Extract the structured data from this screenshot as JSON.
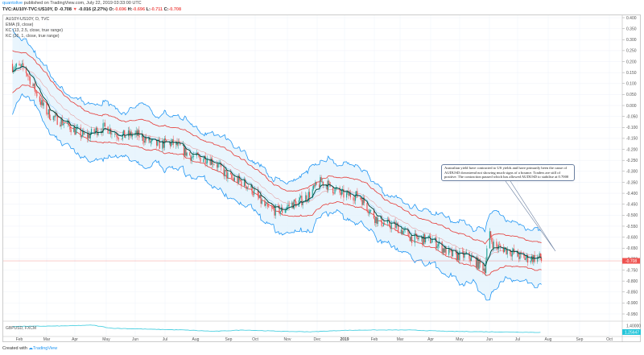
{
  "header": {
    "user": "quantolive",
    "published": "published on TradingView.com, July 22, 2019 03:33:00 UTC",
    "symbol": "TVC:AU10Y-TVC:US10Y, D",
    "last": "-0.708",
    "change_arrow": "▼",
    "change": "-0.016 (2.27%)",
    "o_label": "O:",
    "o": "-0.696",
    "h_label": "H:",
    "h": "-0.696",
    "l_label": "L:",
    "l": "-0.711",
    "c_label": "C:",
    "c": "-0.708"
  },
  "legend": [
    "AU10Y-US10Y, D, TVC",
    "EMA (9, close)",
    "KC (13, 2.5, close, true range)",
    "KC (26, 1, close, true range)"
  ],
  "annotation": "Australian yield have contracted to US yields and have primarily been the cause of AUDUSD downtrend not showing much signs of a bounce. Traders are still of positive. The contraction paused which has allowed AUDUSD to stabilise at 0.7000",
  "footer": {
    "created": "Created with",
    "brand": "TradingView"
  },
  "colors": {
    "up": "#26a69a",
    "down": "#ef5350",
    "ema": "#004d40",
    "kc1": "#2196f3",
    "kc2": "#e53935",
    "fill": "#e3f2fd",
    "sub": "#4dd0e1"
  },
  "chart_data": {
    "type": "candlestick",
    "title": "AU10Y-US10Y, D, TVC",
    "x_unit": "days since 2018-02-01",
    "price_keypoints": [
      [
        -7,
        0.19
      ],
      [
        5,
        0.16
      ],
      [
        14,
        0.08
      ],
      [
        25,
        0.0
      ],
      [
        35,
        -0.05
      ],
      [
        45,
        -0.09
      ],
      [
        55,
        -0.11
      ],
      [
        70,
        -0.13
      ],
      [
        90,
        -0.11
      ],
      [
        110,
        -0.13
      ],
      [
        130,
        -0.16
      ],
      [
        150,
        -0.17
      ],
      [
        170,
        -0.21
      ],
      [
        190,
        -0.24
      ],
      [
        210,
        -0.3
      ],
      [
        225,
        -0.34
      ],
      [
        240,
        -0.4
      ],
      [
        255,
        -0.46
      ],
      [
        270,
        -0.49
      ],
      [
        290,
        -0.42
      ],
      [
        310,
        -0.36
      ],
      [
        325,
        -0.38
      ],
      [
        340,
        -0.41
      ],
      [
        350,
        -0.43
      ],
      [
        365,
        -0.5
      ],
      [
        380,
        -0.55
      ],
      [
        395,
        -0.58
      ],
      [
        410,
        -0.6
      ],
      [
        420,
        -0.62
      ],
      [
        440,
        -0.66
      ],
      [
        455,
        -0.69
      ],
      [
        470,
        -0.72
      ],
      [
        478,
        -0.73
      ],
      [
        482,
        -0.57
      ],
      [
        488,
        -0.64
      ],
      [
        500,
        -0.67
      ],
      [
        515,
        -0.68
      ],
      [
        525,
        -0.69
      ],
      [
        536,
        -0.708
      ]
    ],
    "ema_period": 9,
    "kc_outer": {
      "period": 13,
      "mult": 2.5
    },
    "kc_inner": {
      "period": 26,
      "mult": 1
    },
    "yaxis_ticks": [
      "0.400",
      "0.350",
      "0.300",
      "0.250",
      "0.200",
      "0.150",
      "0.100",
      "0.050",
      "0.000",
      "-0.050",
      "-0.100",
      "-0.150",
      "-0.200",
      "-0.250",
      "-0.300",
      "-0.350",
      "-0.400",
      "-0.450",
      "-0.500",
      "-0.550",
      "-0.600",
      "-0.650",
      "-0.700",
      "-0.750",
      "-0.800",
      "-0.850",
      "-0.900",
      "-0.950"
    ],
    "ylim": [
      -0.97,
      0.41
    ],
    "current_price_label": "-0.708",
    "xaxis_ticks": [
      "Feb",
      "Mar",
      "Apr",
      "May",
      "Jun",
      "Jul",
      "Aug",
      "Sep",
      "Oct",
      "Nov",
      "Dec",
      "2019",
      "Feb",
      "Mar",
      "Apr",
      "May",
      "Jun",
      "Jul",
      "Aug",
      "Sep",
      "Oct"
    ],
    "sub_pane": {
      "title": "GBPUSD, FXCM",
      "tick": "1.40000",
      "last": "1.25647",
      "keypoints": [
        [
          -7,
          1.39
        ],
        [
          40,
          1.4
        ],
        [
          75,
          1.42
        ],
        [
          95,
          1.35
        ],
        [
          130,
          1.33
        ],
        [
          170,
          1.31
        ],
        [
          200,
          1.28
        ],
        [
          230,
          1.31
        ],
        [
          270,
          1.28
        ],
        [
          300,
          1.27
        ],
        [
          330,
          1.3
        ],
        [
          360,
          1.31
        ],
        [
          400,
          1.31
        ],
        [
          440,
          1.28
        ],
        [
          480,
          1.27
        ],
        [
          536,
          1.256
        ]
      ]
    }
  }
}
